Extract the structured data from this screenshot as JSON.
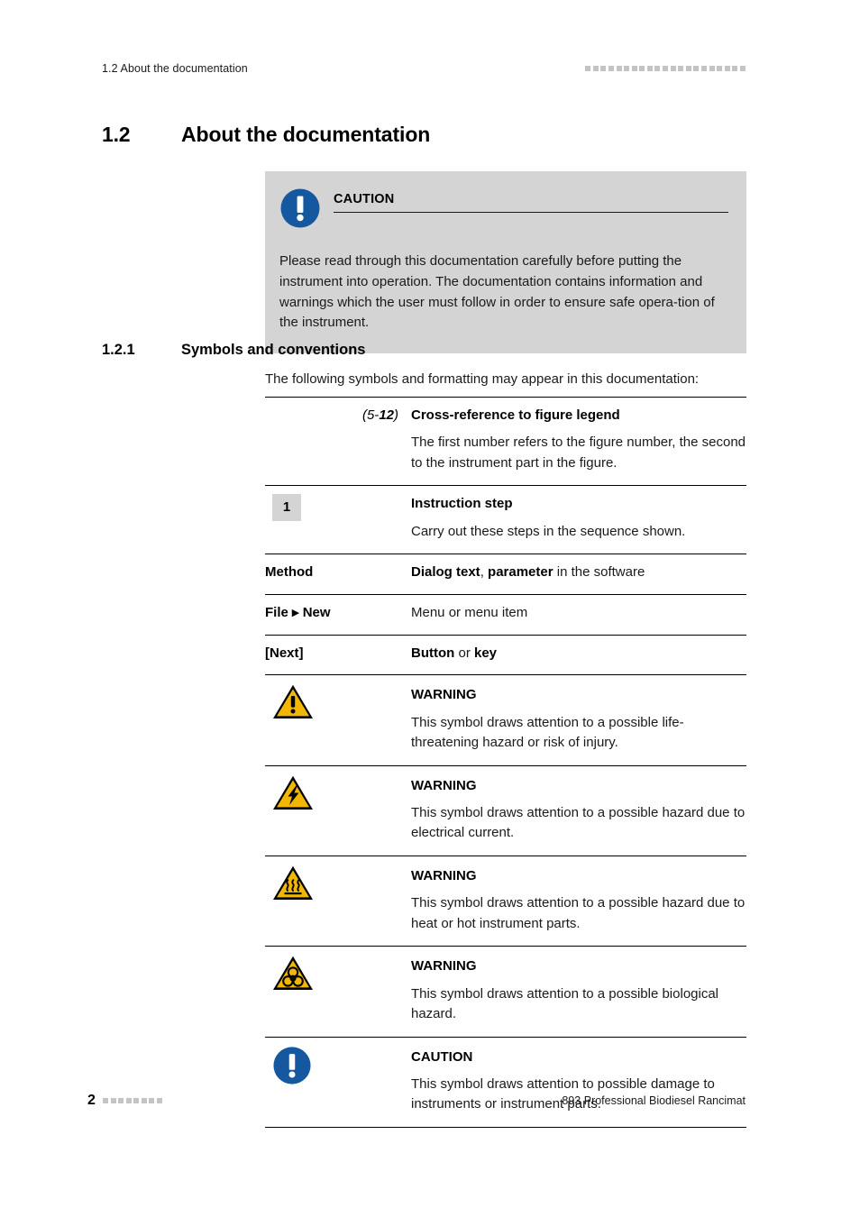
{
  "header": {
    "running_title": "1.2 About the documentation",
    "marker_squares": 21,
    "marker_color": "#c4c4c4"
  },
  "heading": {
    "number": "1.2",
    "title": "About the documentation"
  },
  "callout": {
    "icon": "caution-blue-circle-icon",
    "title": "CAUTION",
    "body": "Please read through this documentation carefully before putting the instrument into operation. The documentation contains information and warnings which the user must follow in order to ensure safe opera-tion of the instrument.",
    "background": "#d4d4d4",
    "icon_color": "#15589f"
  },
  "subheading": {
    "number": "1.2.1",
    "title": "Symbols and conventions"
  },
  "intro": "The following symbols and formatting may appear in this documentation:",
  "table": {
    "rows": [
      {
        "id": "cross-reference",
        "left_type": "xref",
        "left_prefix": "(5-",
        "left_bold": "12",
        "left_suffix": ")",
        "title": "Cross-reference to figure legend",
        "desc": "The first number refers to the figure number, the second to the instrument part in the figure."
      },
      {
        "id": "instruction-step",
        "left_type": "stepbox",
        "left_value": "1",
        "title": "Instruction step",
        "desc": "Carry out these steps in the sequence shown."
      },
      {
        "id": "method",
        "left_type": "label-bold",
        "left_value": "Method",
        "rich_right": [
          {
            "text": "Dialog text",
            "bold": true
          },
          {
            "text": ", ",
            "bold": false
          },
          {
            "text": "parameter",
            "bold": true
          },
          {
            "text": " in the software",
            "bold": false
          }
        ]
      },
      {
        "id": "menu-path",
        "left_type": "label-bold",
        "left_value": "File ▸ New",
        "rich_right": [
          {
            "text": "Menu or menu item",
            "bold": false
          }
        ]
      },
      {
        "id": "button-key",
        "left_type": "label-bold",
        "left_value": "[Next]",
        "rich_right": [
          {
            "text": "Button",
            "bold": true
          },
          {
            "text": " or ",
            "bold": false
          },
          {
            "text": "key",
            "bold": true
          }
        ]
      },
      {
        "id": "warning-general",
        "left_type": "icon",
        "icon": "warning-triangle-exclamation-icon",
        "title": "WARNING",
        "desc": "This symbol draws attention to a possible life-threatening hazard or risk of injury."
      },
      {
        "id": "warning-electrical",
        "left_type": "icon",
        "icon": "warning-triangle-lightning-icon",
        "title": "WARNING",
        "desc": "This symbol draws attention to a possible hazard due to electrical current."
      },
      {
        "id": "warning-hot-surface",
        "left_type": "icon",
        "icon": "warning-triangle-hot-surface-icon",
        "title": "WARNING",
        "desc": "This symbol draws attention to a possible hazard due to heat or hot instrument parts."
      },
      {
        "id": "warning-biohazard",
        "left_type": "icon",
        "icon": "warning-triangle-biohazard-icon",
        "title": "WARNING",
        "desc": "This symbol draws attention to a possible biological hazard."
      },
      {
        "id": "caution-damage",
        "left_type": "icon",
        "icon": "caution-blue-circle-icon",
        "title": "CAUTION",
        "desc": "This symbol draws attention to possible damage to instruments or instrument parts."
      }
    ]
  },
  "footer": {
    "page_number": "2",
    "marker_squares": 8,
    "document_title": "893 Professional Biodiesel Rancimat"
  },
  "colors": {
    "warning_yellow": "#f2b705",
    "warning_outline": "#000000",
    "caution_blue": "#15589f",
    "rule": "#000000",
    "grey_box": "#d4d4d4"
  }
}
